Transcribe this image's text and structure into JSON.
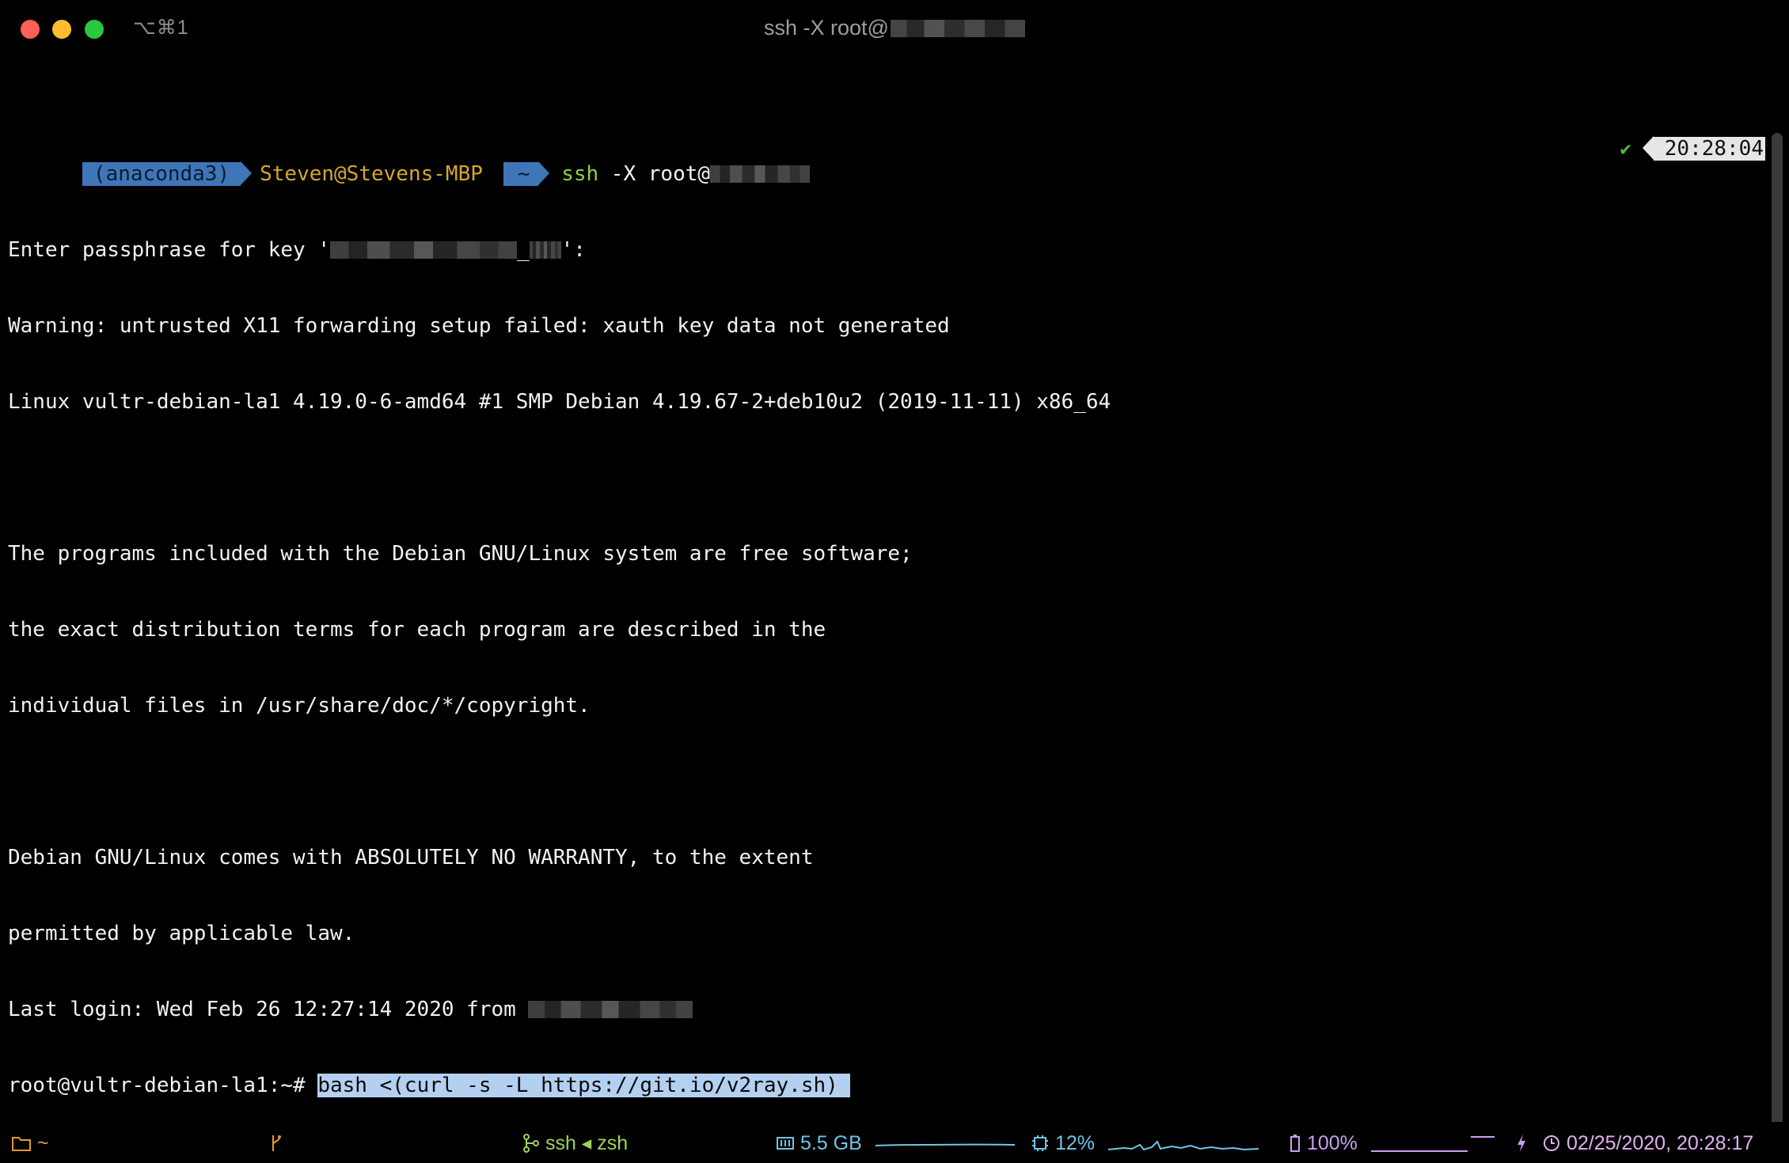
{
  "titlebar": {
    "tab_shortcut": "⌥⌘1",
    "title": "ssh -X root@"
  },
  "prompt": {
    "env": "(anaconda3)",
    "user_host": "Steven@Stevens-MBP",
    "dir": "~",
    "cmd_name": "ssh",
    "cmd_args": " -X root@",
    "status_check": "✔",
    "time": "20:28:04"
  },
  "output": {
    "passphrase_prefix": "Enter passphrase for key '",
    "passphrase_mid": "_",
    "passphrase_suffix": "':",
    "warning": "Warning: untrusted X11 forwarding setup failed: xauth key data not generated",
    "uname": "Linux vultr-debian-la1 4.19.0-6-amd64 #1 SMP Debian 4.19.67-2+deb10u2 (2019-11-11) x86_64",
    "motd_1": "The programs included with the Debian GNU/Linux system are free software;",
    "motd_2": "the exact distribution terms for each program are described in the",
    "motd_3": "individual files in /usr/share/doc/*/copyright.",
    "motd_4": "Debian GNU/Linux comes with ABSOLUTELY NO WARRANTY, to the extent",
    "motd_5": "permitted by applicable law.",
    "last_login": "Last login: Wed Feb 26 12:27:14 2020 from ",
    "root_prompt": "root@vultr-debian-la1:~# ",
    "root_command": "bash <(curl -s -L https://git.io/v2ray.sh) "
  },
  "statusbar": {
    "dir_icon": "folder-icon",
    "dir": "~",
    "git_icon": "git-branch-icon",
    "job_icon": "process-tree-icon",
    "job": "ssh ◂ zsh",
    "mem_icon": "memory-icon",
    "mem": "5.5 GB",
    "cpu_icon": "cpu-icon",
    "cpu": "12%",
    "battery_icon": "battery-icon",
    "battery": "100%",
    "charging_icon": "lightning-icon",
    "clock_icon": "clock-icon",
    "clock": "02/25/2020, 20:28:17"
  },
  "colors": {
    "prompt_segment": "#3f76b8",
    "user_host": "#d6a72c",
    "ssh_cmd": "#8fd246",
    "selection": "#b4d0f0",
    "status_dir": "#e69a2e",
    "status_job": "#9ed25a",
    "status_mem_cpu": "#6ec5e8",
    "status_battery": "#c8a0f0",
    "status_clock": "#e0b0f0"
  }
}
